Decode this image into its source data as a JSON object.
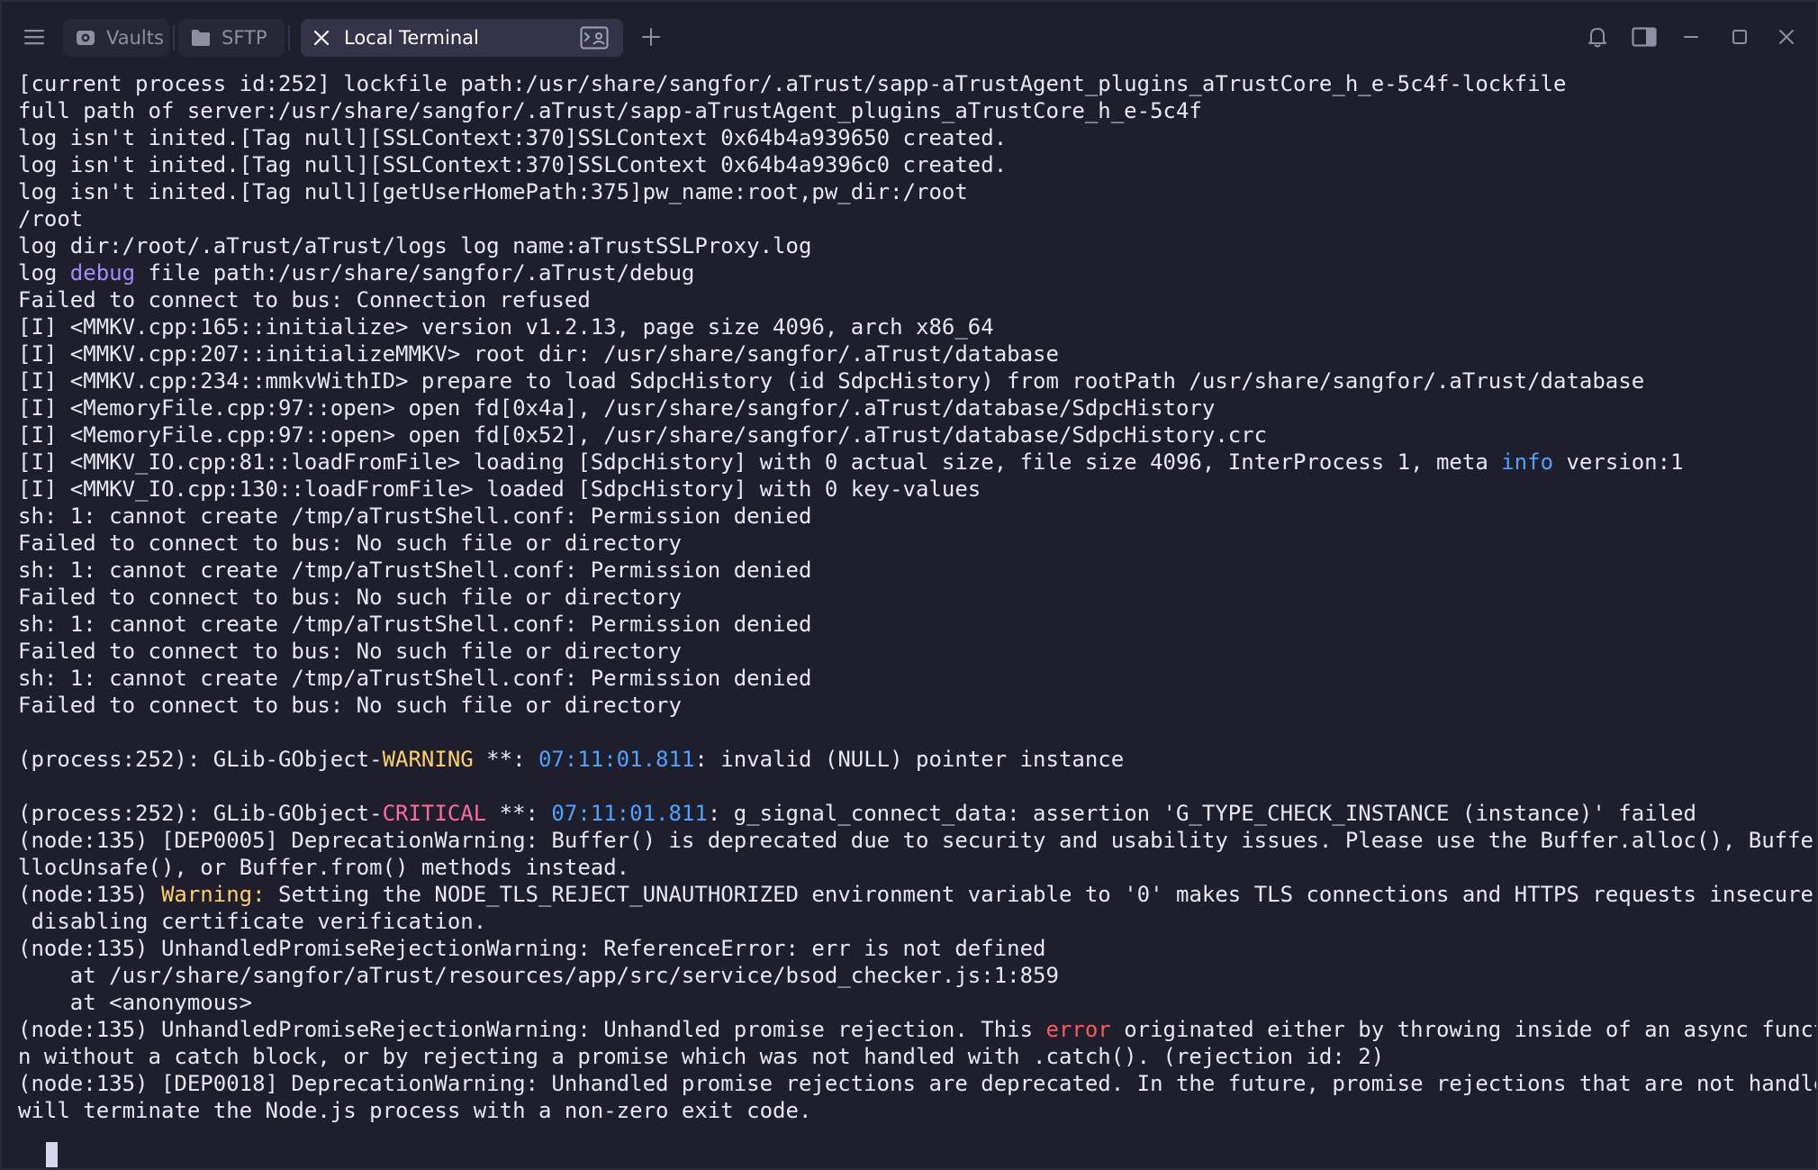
{
  "titlebar": {
    "tabs": [
      {
        "label": "Vaults",
        "icon": "vault-icon"
      },
      {
        "label": "SFTP",
        "icon": "folder-icon"
      },
      {
        "label": "Local Terminal",
        "icon": "terminal-icon",
        "active": true
      }
    ]
  },
  "colors": {
    "background": "#1e1e2c",
    "active_tab": "#33344a",
    "debug": "#a48cff",
    "info": "#4fa3ff",
    "warning": "#ffcf6b",
    "critical": "#ff6b9a",
    "error": "#ff5a5a"
  },
  "terminal": {
    "lines": [
      [
        {
          "t": "[current process id:252] lockfile path:/usr/share/sangfor/.aTrust/sapp-aTrustAgent_plugins_aTrustCore_h_e-5c4f-lockfile"
        }
      ],
      [
        {
          "t": "full path of server:/usr/share/sangfor/.aTrust/sapp-aTrustAgent_plugins_aTrustCore_h_e-5c4f"
        }
      ],
      [
        {
          "t": "log isn't inited.[Tag null][SSLContext:370]SSLContext 0x64b4a939650 created."
        }
      ],
      [
        {
          "t": "log isn't inited.[Tag null][SSLContext:370]SSLContext 0x64b4a9396c0 created."
        }
      ],
      [
        {
          "t": "log isn't inited.[Tag null][getUserHomePath:375]pw_name:root,pw_dir:/root"
        }
      ],
      [
        {
          "t": "/root"
        }
      ],
      [
        {
          "t": "log dir:/root/.aTrust/aTrust/logs log name:aTrustSSLProxy.log"
        }
      ],
      [
        {
          "t": "log "
        },
        {
          "t": "debug",
          "c": "purple"
        },
        {
          "t": " file path:/usr/share/sangfor/.aTrust/debug"
        }
      ],
      [
        {
          "t": "Failed to connect to bus: Connection refused"
        }
      ],
      [
        {
          "t": "[I] <MMKV.cpp:165::initialize> version v1.2.13, page size 4096, arch x86_64"
        }
      ],
      [
        {
          "t": "[I] <MMKV.cpp:207::initializeMMKV> root dir: /usr/share/sangfor/.aTrust/database"
        }
      ],
      [
        {
          "t": "[I] <MMKV.cpp:234::mmkvWithID> prepare to load SdpcHistory (id SdpcHistory) from rootPath /usr/share/sangfor/.aTrust/database"
        }
      ],
      [
        {
          "t": "[I] <MemoryFile.cpp:97::open> open fd[0x4a], /usr/share/sangfor/.aTrust/database/SdpcHistory"
        }
      ],
      [
        {
          "t": "[I] <MemoryFile.cpp:97::open> open fd[0x52], /usr/share/sangfor/.aTrust/database/SdpcHistory.crc"
        }
      ],
      [
        {
          "t": "[I] <MMKV_IO.cpp:81::loadFromFile> loading [SdpcHistory] with 0 actual size, file size 4096, InterProcess 1, meta "
        },
        {
          "t": "info",
          "c": "blue"
        },
        {
          "t": " version:1"
        }
      ],
      [
        {
          "t": "[I] <MMKV_IO.cpp:130::loadFromFile> loaded [SdpcHistory] with 0 key-values"
        }
      ],
      [
        {
          "t": "sh: 1: cannot create /tmp/aTrustShell.conf: Permission denied"
        }
      ],
      [
        {
          "t": "Failed to connect to bus: No such file or directory"
        }
      ],
      [
        {
          "t": "sh: 1: cannot create /tmp/aTrustShell.conf: Permission denied"
        }
      ],
      [
        {
          "t": "Failed to connect to bus: No such file or directory"
        }
      ],
      [
        {
          "t": "sh: 1: cannot create /tmp/aTrustShell.conf: Permission denied"
        }
      ],
      [
        {
          "t": "Failed to connect to bus: No such file or directory"
        }
      ],
      [
        {
          "t": "sh: 1: cannot create /tmp/aTrustShell.conf: Permission denied"
        }
      ],
      [
        {
          "t": "Failed to connect to bus: No such file or directory"
        }
      ],
      [
        {
          "t": ""
        }
      ],
      [
        {
          "t": "(process:252): GLib-GObject-"
        },
        {
          "t": "WARNING",
          "c": "yellow"
        },
        {
          "t": " **: "
        },
        {
          "t": "07:11:01.811",
          "c": "blue"
        },
        {
          "t": ": invalid (NULL) pointer instance"
        }
      ],
      [
        {
          "t": ""
        }
      ],
      [
        {
          "t": "(process:252): GLib-GObject-"
        },
        {
          "t": "CRITICAL",
          "c": "pink"
        },
        {
          "t": " **: "
        },
        {
          "t": "07:11:01.811",
          "c": "blue"
        },
        {
          "t": ": g_signal_connect_data: assertion 'G_TYPE_CHECK_INSTANCE (instance)' failed"
        }
      ],
      [
        {
          "t": "(node:135) [DEP0005] DeprecationWarning: Buffer() is deprecated due to security and usability issues. Please use the Buffer.alloc(), Buffer.a"
        }
      ],
      [
        {
          "t": "llocUnsafe(), or Buffer.from() methods instead."
        }
      ],
      [
        {
          "t": "(node:135) "
        },
        {
          "t": "Warning:",
          "c": "yellow"
        },
        {
          "t": " Setting the NODE_TLS_REJECT_UNAUTHORIZED environment variable to '0' makes TLS connections and HTTPS requests insecure by"
        }
      ],
      [
        {
          "t": " disabling certificate verification."
        }
      ],
      [
        {
          "t": "(node:135) UnhandledPromiseRejectionWarning: ReferenceError: err is not defined"
        }
      ],
      [
        {
          "t": "    at /usr/share/sangfor/aTrust/resources/app/src/service/bsod_checker.js:1:859"
        }
      ],
      [
        {
          "t": "    at <anonymous>"
        }
      ],
      [
        {
          "t": "(node:135) UnhandledPromiseRejectionWarning: Unhandled promise rejection. This "
        },
        {
          "t": "error",
          "c": "red"
        },
        {
          "t": " originated either by throwing inside of an async functio"
        }
      ],
      [
        {
          "t": "n without a catch block, or by rejecting a promise which was not handled with .catch(). (rejection id: 2)"
        }
      ],
      [
        {
          "t": "(node:135) [DEP0018] DeprecationWarning: Unhandled promise rejections are deprecated. In the future, promise rejections that are not handled"
        }
      ],
      [
        {
          "t": "will terminate the Node.js process with a non-zero exit code."
        }
      ]
    ]
  }
}
